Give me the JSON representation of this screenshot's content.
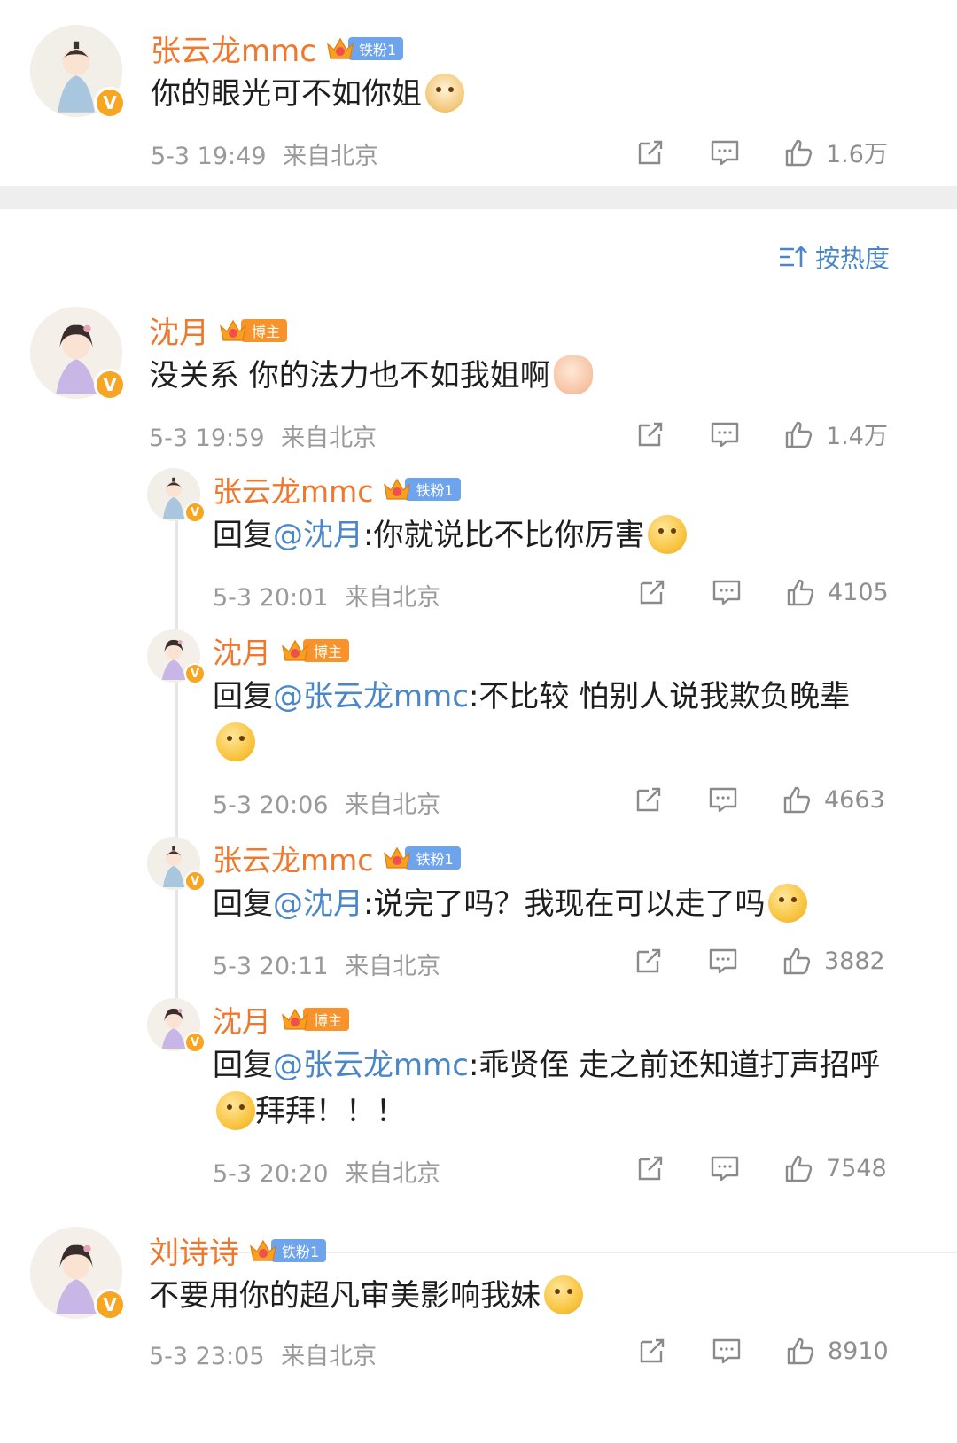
{
  "top_comment": {
    "user": "张云龙mmc",
    "badge": "铁粉1",
    "text": "你的眼光可不如你姐",
    "emoji": "doge-emoji",
    "time": "5-3 19:49",
    "location": "来自北京",
    "likes": "1.6万"
  },
  "sort": {
    "label": "按热度",
    "icon": "sort-icon"
  },
  "main_comment": {
    "user": "沈月",
    "badge": "博主",
    "text": "没关系 你的法力也不如我姐啊",
    "emoji": "hand-emoji",
    "time": "5-3 19:59",
    "location": "来自北京",
    "likes": "1.4万"
  },
  "replies": [
    {
      "user": "张云龙mmc",
      "badge": "铁粉1",
      "prefix": "回复",
      "mention": "@沈月",
      "text": ":你就说比不比你厉害",
      "time": "5-3 20:01",
      "location": "来自北京",
      "likes": "4105"
    },
    {
      "user": "沈月",
      "badge": "博主",
      "prefix": "回复",
      "mention": "@张云龙mmc",
      "text": ":不比较 怕别人说我欺负晚辈",
      "time": "5-3 20:06",
      "location": "来自北京",
      "likes": "4663"
    },
    {
      "user": "张云龙mmc",
      "badge": "铁粉1",
      "prefix": "回复",
      "mention": "@沈月",
      "text": ":说完了吗？我现在可以走了吗",
      "time": "5-3 20:11",
      "location": "来自北京",
      "likes": "3882"
    },
    {
      "user": "沈月",
      "badge": "博主",
      "prefix": "回复",
      "mention": "@张云龙mmc",
      "text": ":乖贤侄 走之前还知道打声招呼",
      "text2": "拜拜！！！",
      "time": "5-3 20:20",
      "location": "来自北京",
      "likes": "7548"
    }
  ],
  "last_comment": {
    "user": "刘诗诗",
    "badge": "铁粉1",
    "text": "不要用你的超凡审美影响我妹",
    "time": "5-3 23:05",
    "location": "来自北京",
    "likes": "8910"
  },
  "verified_badge": "V",
  "colors": {
    "username": "#f0782d",
    "mention": "#4a86c8",
    "meta": "#9a9a9a",
    "fan_badge": "#6ea4ec",
    "host_badge": "#f7932a"
  }
}
